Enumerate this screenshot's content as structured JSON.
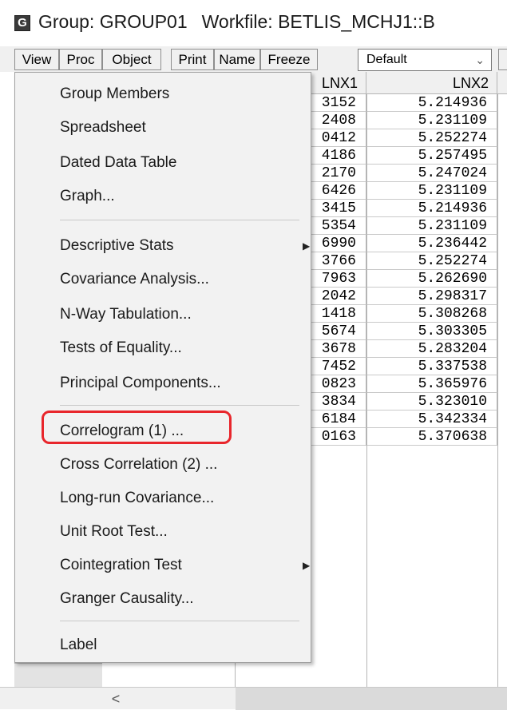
{
  "title": {
    "icon_letter": "G",
    "group": "Group: GROUP01",
    "workfile": "Workfile: BETLIS_MCHJ1::B"
  },
  "toolbar": {
    "view": "View",
    "proc": "Proc",
    "object": "Object",
    "print": "Print",
    "name": "Name",
    "freeze": "Freeze",
    "select_value": "Default"
  },
  "columns": {
    "lnx1": "LNX1",
    "lnx2": "LNX2"
  },
  "rows": [
    {
      "lnx1": "3152",
      "lnx2": "5.214936"
    },
    {
      "lnx1": "2408",
      "lnx2": "5.231109"
    },
    {
      "lnx1": "0412",
      "lnx2": "5.252274"
    },
    {
      "lnx1": "4186",
      "lnx2": "5.257495"
    },
    {
      "lnx1": "2170",
      "lnx2": "5.247024"
    },
    {
      "lnx1": "6426",
      "lnx2": "5.231109"
    },
    {
      "lnx1": "3415",
      "lnx2": "5.214936"
    },
    {
      "lnx1": "5354",
      "lnx2": "5.231109"
    },
    {
      "lnx1": "6990",
      "lnx2": "5.236442"
    },
    {
      "lnx1": "3766",
      "lnx2": "5.252274"
    },
    {
      "lnx1": "7963",
      "lnx2": "5.262690"
    },
    {
      "lnx1": "2042",
      "lnx2": "5.298317"
    },
    {
      "lnx1": "1418",
      "lnx2": "5.308268"
    },
    {
      "lnx1": "5674",
      "lnx2": "5.303305"
    },
    {
      "lnx1": "3678",
      "lnx2": "5.283204"
    },
    {
      "lnx1": "7452",
      "lnx2": "5.337538"
    },
    {
      "lnx1": "0823",
      "lnx2": "5.365976"
    },
    {
      "lnx1": "3834",
      "lnx2": "5.323010"
    },
    {
      "lnx1": "6184",
      "lnx2": "5.342334"
    },
    {
      "lnx1": "0163",
      "lnx2": "5.370638"
    }
  ],
  "menu": {
    "items": [
      "Group Members",
      "Spreadsheet",
      "Dated Data Table",
      "Graph...",
      "Descriptive Stats",
      "Covariance Analysis...",
      "N-Way Tabulation...",
      "Tests of Equality...",
      "Principal Components...",
      "Correlogram (1) ...",
      "Cross Correlation (2) ...",
      "Long-run Covariance...",
      "Unit Root Test...",
      "Cointegration Test",
      "Granger Causality...",
      "Label"
    ],
    "highlighted_item": "Correlogram (1) ...",
    "highlight_color": "#e8262c"
  },
  "scroll_left_glyph": "<"
}
